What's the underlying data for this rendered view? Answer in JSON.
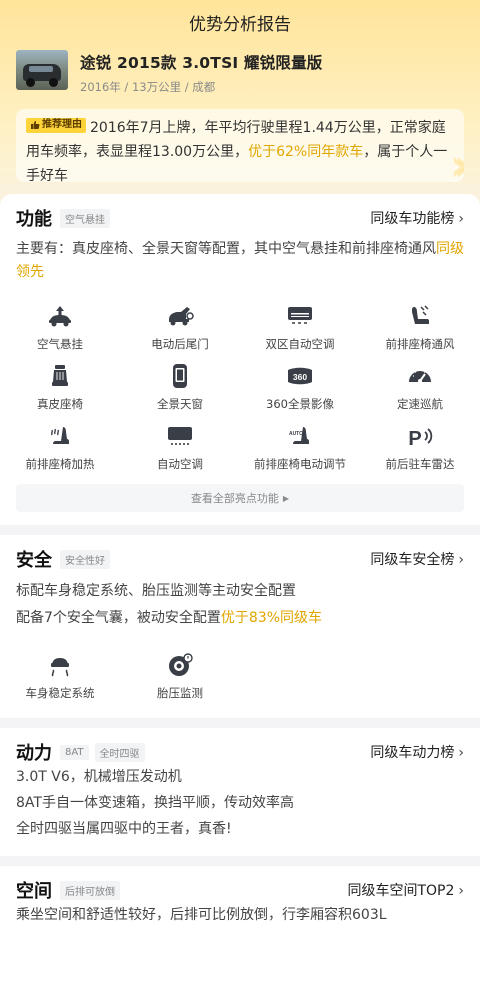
{
  "page": {
    "title": "优势分析报告"
  },
  "car": {
    "name": "途锐 2015款 3.0TSI 耀锐限量版",
    "meta": "2016年 / 13万公里 / 成都"
  },
  "reason": {
    "badge": "推荐理由",
    "text_part1": "2016年7月上牌，年平均行驶里程1.44万公里，正常家庭用车频率，表显里程13.00万公里，",
    "highlight": "优于62%同年款车",
    "text_part2": "，属于个人一手好车"
  },
  "function": {
    "title": "功能",
    "tag": "空气悬挂",
    "rank_label": "同级车功能榜",
    "desc_main": "主要有：真皮座椅、全景天窗等配置，其中空气悬挂和前排座椅通风",
    "desc_highlight": "同级领先",
    "features": [
      {
        "label": "空气悬挂",
        "icon": "air-suspension-icon"
      },
      {
        "label": "电动后尾门",
        "icon": "power-tailgate-icon"
      },
      {
        "label": "双区自动空调",
        "icon": "dual-zone-ac-icon"
      },
      {
        "label": "前排座椅通风",
        "icon": "seat-ventilation-icon"
      },
      {
        "label": "真皮座椅",
        "icon": "leather-seat-icon"
      },
      {
        "label": "全景天窗",
        "icon": "panoramic-sunroof-icon"
      },
      {
        "label": "360全景影像",
        "icon": "camera-360-icon"
      },
      {
        "label": "定速巡航",
        "icon": "cruise-control-icon"
      },
      {
        "label": "前排座椅加热",
        "icon": "seat-heating-icon"
      },
      {
        "label": "自动空调",
        "icon": "auto-ac-icon"
      },
      {
        "label": "前排座椅电动调节",
        "icon": "power-seat-icon"
      },
      {
        "label": "前后驻车雷达",
        "icon": "parking-radar-icon"
      }
    ],
    "show_all": "查看全部亮点功能"
  },
  "safety": {
    "title": "安全",
    "tag": "安全性好",
    "rank_label": "同级车安全榜",
    "line1": "标配车身稳定系统、胎压监测等主动安全配置",
    "line2_main": "配备7个安全气囊，被动安全配置",
    "line2_highlight": "优于83%同级车",
    "features": [
      {
        "label": "车身稳定系统",
        "icon": "stability-control-icon"
      },
      {
        "label": "胎压监测",
        "icon": "tire-pressure-icon"
      }
    ]
  },
  "power": {
    "title": "动力",
    "tags": [
      "8AT",
      "全时四驱"
    ],
    "rank_label": "同级车动力榜",
    "lines": [
      "3.0T V6，机械增压发动机",
      "8AT手自一体变速箱，换挡平顺，传动效率高",
      "全时四驱当属四驱中的王者，真香!"
    ]
  },
  "space": {
    "title": "空间",
    "tag": "后排可放倒",
    "rank_label": "同级车空间TOP2",
    "line1": "乘坐空间和舒适性较好，后排可比例放倒，行李厢容积603L"
  },
  "colors": {
    "accent": "#e0a600",
    "badge": "#ffd33a"
  }
}
